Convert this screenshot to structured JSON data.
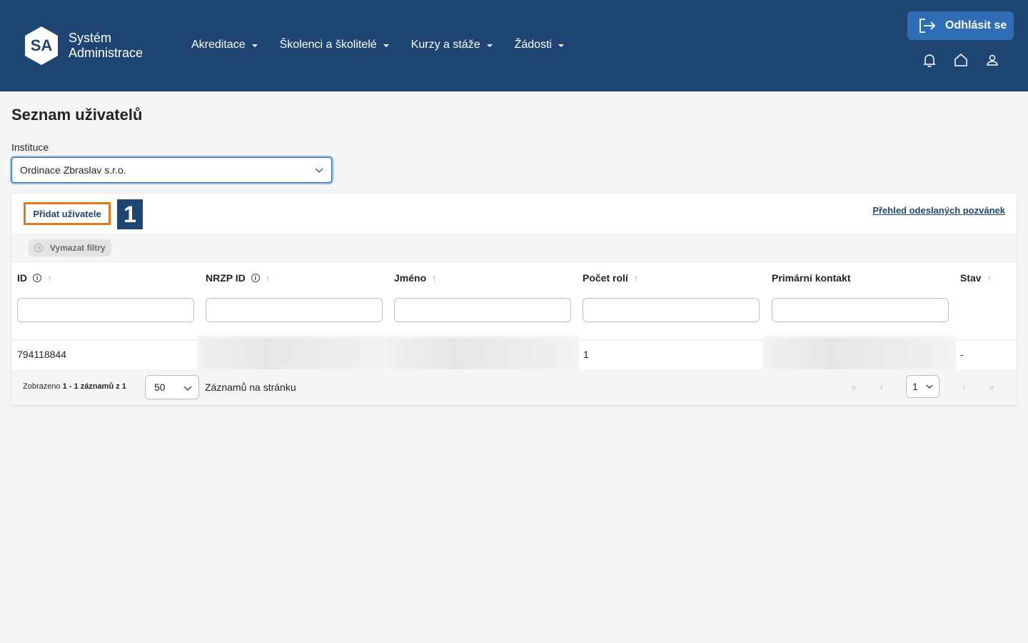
{
  "header": {
    "logo_text": "SA",
    "brand_line1": "Systém",
    "brand_line2": "Administrace",
    "nav": [
      {
        "label": "Akreditace"
      },
      {
        "label": "Školenci a školitelé"
      },
      {
        "label": "Kurzy a stáže"
      },
      {
        "label": "Žádosti"
      }
    ],
    "logout_label": "Odhlásit se",
    "icons": [
      "bell-icon",
      "home-icon",
      "user-icon"
    ]
  },
  "page": {
    "title": "Seznam uživatelů",
    "institution_label": "Instituce",
    "institution_value": "Ordinace Zbraslav s.r.o."
  },
  "toolbar": {
    "add_user_label": "Přidat uživatele",
    "step_number": "1",
    "invites_link": "Přehled odeslaných pozvánek",
    "clear_filters_label": "Vymazat filtry"
  },
  "table": {
    "columns": [
      {
        "label": "ID",
        "info": true,
        "sortable": true
      },
      {
        "label": "NRZP ID",
        "info": true,
        "sortable": true
      },
      {
        "label": "Jméno",
        "info": false,
        "sortable": true
      },
      {
        "label": "Počet rolí",
        "info": false,
        "sortable": true
      },
      {
        "label": "Primární kontakt",
        "info": false,
        "sortable": false
      },
      {
        "label": "Stav",
        "info": false,
        "sortable": true
      }
    ],
    "rows": [
      {
        "id": "794118844",
        "nrzp_id": "",
        "name": "",
        "roles": "1",
        "contact": "",
        "status": "-"
      }
    ]
  },
  "pagination": {
    "shown_prefix": "Zobrazeno ",
    "shown_range": "1 - 1 záznamů z 1",
    "per_page": "50",
    "per_page_label": "Záznamů na stránku",
    "current_page": "1"
  },
  "colors": {
    "header_bg": "#1f4572",
    "accent": "#2e6db4",
    "highlight": "#e07b18"
  }
}
